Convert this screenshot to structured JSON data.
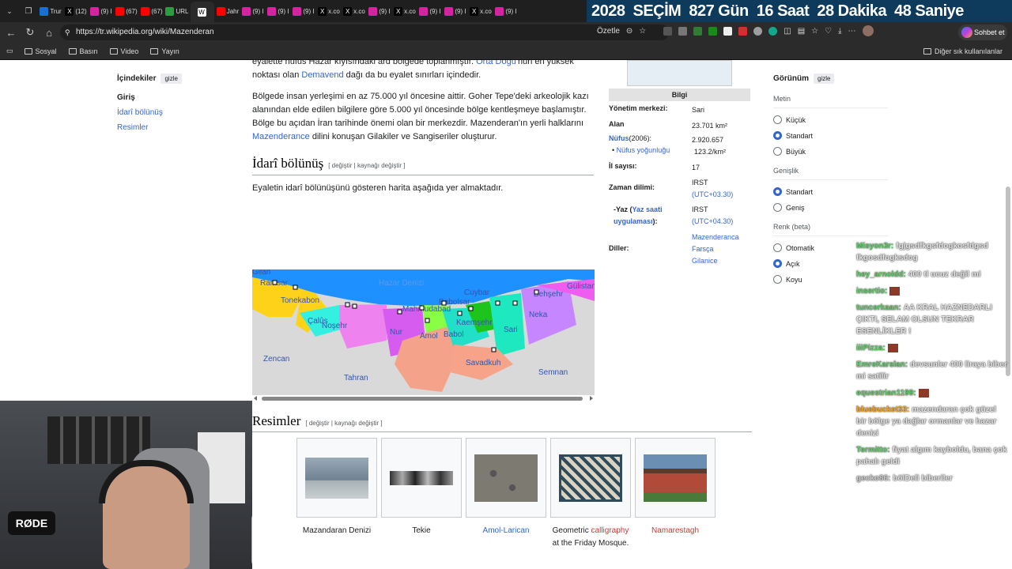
{
  "tabs": [
    {
      "label": "Trur",
      "color": "#1a6fd1",
      "icon": "tba"
    },
    {
      "label": "(12)",
      "color": "#000000",
      "icon": "x-icon"
    },
    {
      "label": "(9) I",
      "color": "#d6249f",
      "icon": "instagram-icon"
    },
    {
      "label": "(67)",
      "color": "#ff0000",
      "icon": "youtube-icon"
    },
    {
      "label": "(67)",
      "color": "#ff0000",
      "icon": "youtube-icon"
    },
    {
      "label": "URL",
      "color": "#2a9d3f",
      "icon": "url-icon"
    },
    {
      "label": "",
      "color": "#ffffff",
      "icon": "wikipedia-icon"
    },
    {
      "label": "Jahr",
      "color": "#ff0000",
      "icon": "youtube-icon"
    },
    {
      "label": "(9) I",
      "color": "#d6249f",
      "icon": "instagram-icon"
    },
    {
      "label": "(9) I",
      "color": "#d6249f",
      "icon": "instagram-icon"
    },
    {
      "label": "(9) I",
      "color": "#d6249f",
      "icon": "instagram-icon"
    },
    {
      "label": "x.co",
      "color": "#000000",
      "icon": "x-icon"
    },
    {
      "label": "x.co",
      "color": "#000000",
      "icon": "x-icon"
    },
    {
      "label": "(9) I",
      "color": "#d6249f",
      "icon": "instagram-icon"
    },
    {
      "label": "x.co",
      "color": "#000000",
      "icon": "x-icon"
    },
    {
      "label": "(9) I",
      "color": "#d6249f",
      "icon": "instagram-icon"
    },
    {
      "label": "(9) I",
      "color": "#d6249f",
      "icon": "instagram-icon"
    },
    {
      "label": "x.co",
      "color": "#000000",
      "icon": "x-icon"
    },
    {
      "label": "(9) I",
      "color": "#d6249f",
      "icon": "instagram-icon"
    }
  ],
  "countdown": {
    "year": "2028",
    "label": "SEÇİM",
    "days": "827 Gün",
    "hours": "16 Saat",
    "minutes": "28 Dakika",
    "seconds": "48 Saniye"
  },
  "addressbar": {
    "url": "https://tr.wikipedia.org/wiki/Mazenderan",
    "summarize": "Özetle",
    "chat": "Sohbet et"
  },
  "bookmarks": {
    "items": [
      "Sosyal",
      "Basın",
      "Video",
      "Yayın"
    ],
    "other": "Diğer sık kullanılanlar"
  },
  "toc": {
    "title": "İçindekiler",
    "toggle": "gizle",
    "items": [
      "Giriş",
      "İdarî bölünüş",
      "Resimler"
    ]
  },
  "article": {
    "p0_a": "eyalette nüfus Hazar kıyısındaki ard bölgede toplanmıştır. ",
    "p0_link": "Orta Doğu",
    "p0_b": "'nun en yüksek noktası olan ",
    "p0_link2": "Demavend",
    "p0_c": " dağı da bu eyalet sınırları içindedir.",
    "p1_a": "Bölgede insan yerleşimi en az 75.000 yıl öncesine aittir. Goher Tepe'deki arkeolojik kazı alanından elde edilen bilgilere göre 5.000 yıl öncesinde bölge kentleşmeye başlamıştır. Bölge bu açıdan İran tarihinde önemi olan bir merkezdir. Mazenderan'ın yerli halklarını ",
    "p1_link": "Mazenderance",
    "p1_b": " dilini konuşan Gilakiler ve Sangiseriler oluşturur.",
    "h_idari": "İdarî bölünüş",
    "edit_links": "[ değiştir | kaynağı değiştir ]",
    "p2": "Eyaletin idarî bölünüşünü gösteren harita aşağıda yer almaktadır.",
    "h_resimler": "Resimler"
  },
  "map_labels": [
    "Gilan",
    "Ramsar",
    "Hazar Denizi",
    "Tonekabon",
    "Çalûs",
    "Noşehr",
    "Nur",
    "Mahmudabad",
    "Babolsar",
    "Cuybar",
    "Behşehr",
    "Gülistan",
    "Amol",
    "Babol",
    "Kaemşehr",
    "Sari",
    "Neka",
    "Savadkuh",
    "Zencan",
    "Tahran",
    "Semnan"
  ],
  "infobox": {
    "header": "Bilgi",
    "rows": [
      {
        "label": "Yönetim merkezi:",
        "value": "Sari"
      },
      {
        "label": "Alan",
        "value": "23.701 km²"
      },
      {
        "label": "Nüfus",
        "label_suffix": "(2006):",
        "value": "2.920.657"
      },
      {
        "label": "Nüfus yoğunluğu",
        "value": "123.2/km²"
      },
      {
        "label": "İl sayısı:",
        "value": "17"
      },
      {
        "label": "Zaman dilimi:",
        "value": "IRST",
        "value2": "(UTC+03.30)"
      },
      {
        "label": "-Yaz",
        "label_link": "Yaz saati uygulaması",
        "value": "IRST",
        "value2": "(UTC+04.30)"
      },
      {
        "label": "Diller:",
        "values": [
          "Mazenderanca",
          "Farsça",
          "Gilanice"
        ]
      }
    ]
  },
  "appearance": {
    "title": "Görünüm",
    "toggle": "gizle",
    "text_section": "Metin",
    "text_options": [
      "Küçük",
      "Standart",
      "Büyük"
    ],
    "text_selected": "Standart",
    "width_section": "Genişlik",
    "width_options": [
      "Standart",
      "Geniş"
    ],
    "width_selected": "Standart",
    "color_section": "Renk (beta)",
    "color_options": [
      "Otomatik",
      "Açık",
      "Koyu"
    ],
    "color_selected": "Açık"
  },
  "gallery": [
    {
      "caption": "Mazandaran Denizi",
      "type": "plain"
    },
    {
      "caption": "Tekie",
      "type": "plain"
    },
    {
      "caption": "Amol-Larican",
      "type": "link"
    },
    {
      "caption_a": "Geometric ",
      "caption_link": "calligraphy",
      "caption_b": " at the Friday Mosque.",
      "type": "mixed"
    },
    {
      "caption": "Namarestagh",
      "type": "red"
    }
  ],
  "chat": [
    {
      "user": "Misyon3r:",
      "color": "#5fd068",
      "msg": "fgjgsdfkgsfdogkosfdgsd fkgosdfogksdog"
    },
    {
      "user": "hey_arnoldd:",
      "color": "#5fd068",
      "msg": "400 tl ucuz değil mi"
    },
    {
      "user": "insertio:",
      "color": "#5fd068",
      "msg": ""
    },
    {
      "user": "tuncerkaan:",
      "color": "#5fd068",
      "msg": "AA KRAL HAZNEDARLI ÇIKTI, SELAM OLSUN TEKRAR ESENLİKLER !"
    },
    {
      "user": "iiiPizza:",
      "color": "#5fd068",
      "msg": ""
    },
    {
      "user": "EmreKarslan:",
      "color": "#5fd068",
      "msg": "devsunler 400 liraya biber mi satilir"
    },
    {
      "user": "equestrian1199:",
      "color": "#5fd068",
      "msg": ""
    },
    {
      "user": "bluebucket33:",
      "color": "#f5a623",
      "msg": "mazendaran çok güzel bir bölge ya dağlar ormanlar ve hazar denizi"
    },
    {
      "user": "Termitto:",
      "color": "#5fd068",
      "msg": "fiyat algım kayboldu, bana çok pahalı geldi"
    },
    {
      "user": "gecko86:",
      "color": "#cfcfcf",
      "msg": "bölDeli biberiler"
    }
  ],
  "colors": {
    "link": "#3366cc",
    "redlink": "#d73333",
    "counter_bg": "#0e3a5c",
    "browser_bg": "#2b2b2b"
  }
}
